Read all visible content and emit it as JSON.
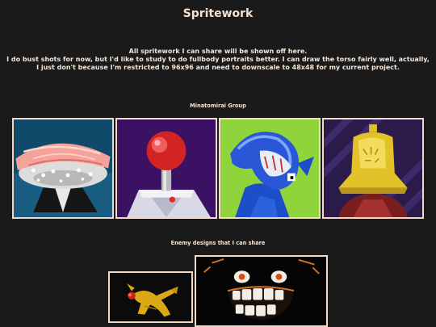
{
  "page": {
    "title": "Spritework",
    "intro_line1": "All spritework I can share will be shown off here.",
    "intro_line2": "I do bust shots for now, but I'd like to study to do fullbody portraits better. I can draw the torso fairly well, actually, I just don't because I'm restricted to 96x96 and need to downscale to 48x48 for my current project."
  },
  "sections": [
    {
      "title": "Minatomirai Group",
      "images": [
        {
          "name": "sprite-sushi-head",
          "bg": "#0f4a6b"
        },
        {
          "name": "sprite-red-knob-head",
          "bg": "#3a1163"
        },
        {
          "name": "sprite-blue-creature",
          "bg": "#8fd43a"
        },
        {
          "name": "sprite-golden-bell-head",
          "bg": "#2a1b4a"
        }
      ]
    },
    {
      "title": "Enemy designs that I can share",
      "images": [
        {
          "name": "sprite-yellow-creature",
          "bg": "#0b0b0b"
        },
        {
          "name": "sprite-grinning-face",
          "bg": "#050505"
        }
      ]
    }
  ],
  "colors": {
    "background": "#1b1a1a",
    "text": "#f6e6d8",
    "frame_border": "#f3d9c8"
  }
}
